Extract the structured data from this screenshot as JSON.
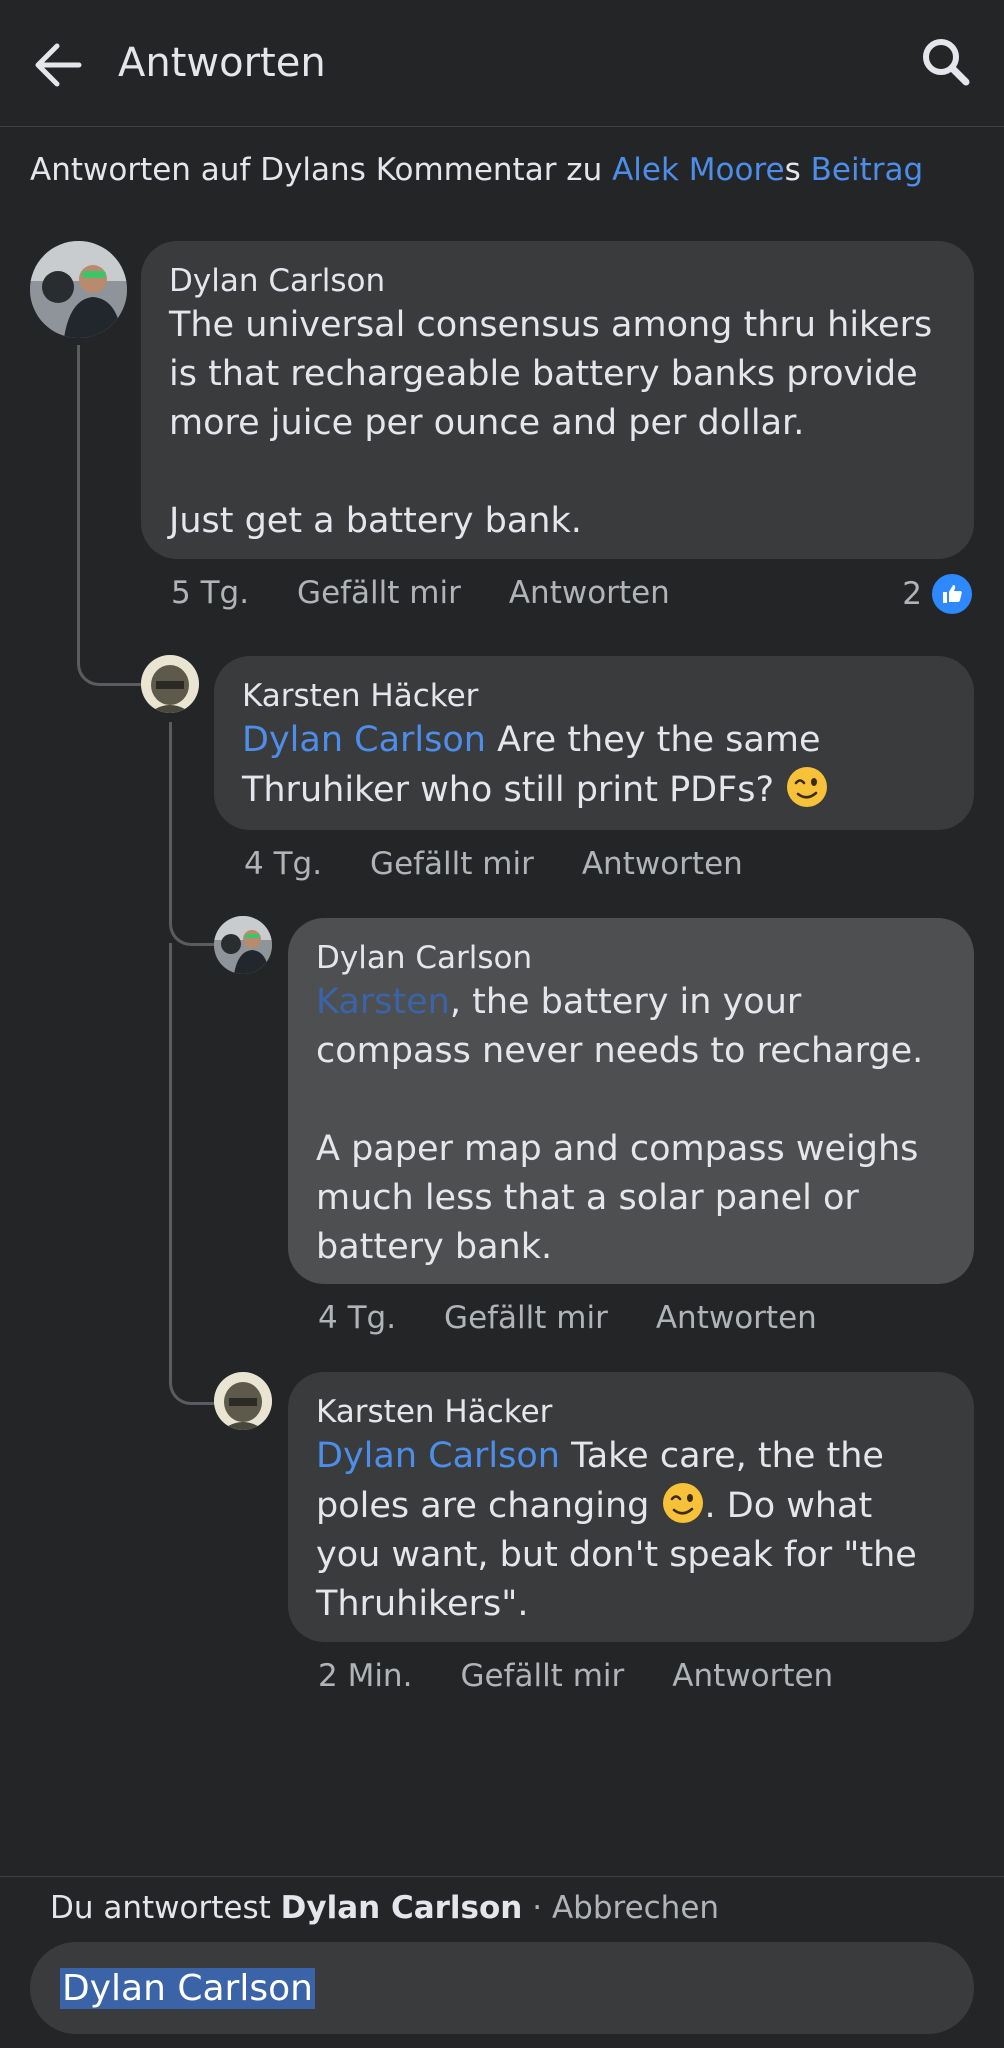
{
  "header": {
    "title": "Antworten",
    "back_icon": "arrow-left-icon",
    "search_icon": "search-icon"
  },
  "context": {
    "prefix": "Antworten auf Dylans Kommentar zu ",
    "post_author": "Alek Moore",
    "possessive": "s ",
    "post_link": "Beitrag"
  },
  "comments": [
    {
      "author": "Dylan Carlson",
      "text": "The universal consensus among thru hikers is that rechargeable battery banks provide more juice per ounce and per dollar.\n\nJust get a battery bank.",
      "time": "5 Tg.",
      "like": "Gefällt mir",
      "reply": "Antworten",
      "reaction_count": "2"
    },
    {
      "author": "Karsten Häcker",
      "mention": "Dylan Carlson",
      "text": " Are they the same Thruhiker who still print PDFs? ",
      "time": "4 Tg.",
      "like": "Gefällt mir",
      "reply": "Antworten"
    },
    {
      "author": "Dylan Carlson",
      "mention": "Karsten",
      "text": ", the battery in your compass never needs to recharge.\n\nA paper map and compass weighs much less that a solar panel or battery bank.",
      "time": "4 Tg.",
      "like": "Gefällt mir",
      "reply": "Antworten"
    },
    {
      "author": "Karsten Häcker",
      "mention": "Dylan Carlson",
      "text_before": " Take care, the the poles are changing ",
      "text_after": ". Do what you want, but don't speak for \"the Thruhikers\".",
      "time": "2 Min.",
      "like": "Gefällt mir",
      "reply": "Antworten"
    }
  ],
  "composer": {
    "prefix": "Du antwortest ",
    "name": "Dylan Carlson",
    "separator": " · ",
    "cancel": "Abbrechen",
    "input_value": "Dylan Carlson"
  },
  "colors": {
    "background": "#242526",
    "bubble": "#3a3b3c",
    "bubble_highlight": "#4e4f50",
    "link": "#4c8eea",
    "like_blue": "#2e89ff"
  }
}
